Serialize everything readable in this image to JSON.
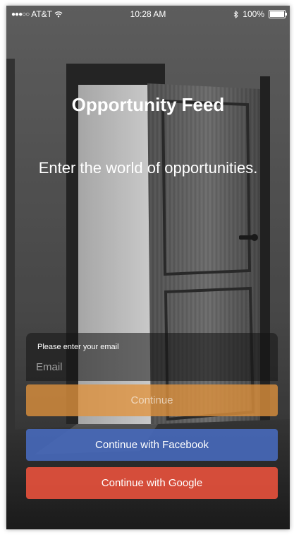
{
  "status_bar": {
    "signal_dots": "●●●○○",
    "carrier": "AT&T",
    "wifi_icon": "wifi-icon",
    "time": "10:28 AM",
    "bluetooth_icon": "bluetooth-icon",
    "battery_percent": "100%",
    "battery_level": 1.0
  },
  "header": {
    "title": "Opportunity Feed",
    "tagline": "Enter the world of opportunities."
  },
  "email": {
    "label": "Please enter your email",
    "placeholder": "Email",
    "value": ""
  },
  "buttons": {
    "continue": "Continue",
    "facebook": "Continue with Facebook",
    "google": "Continue with Google"
  },
  "colors": {
    "continue": "#E0923C",
    "facebook": "#4668B8",
    "google": "#E4503C"
  }
}
